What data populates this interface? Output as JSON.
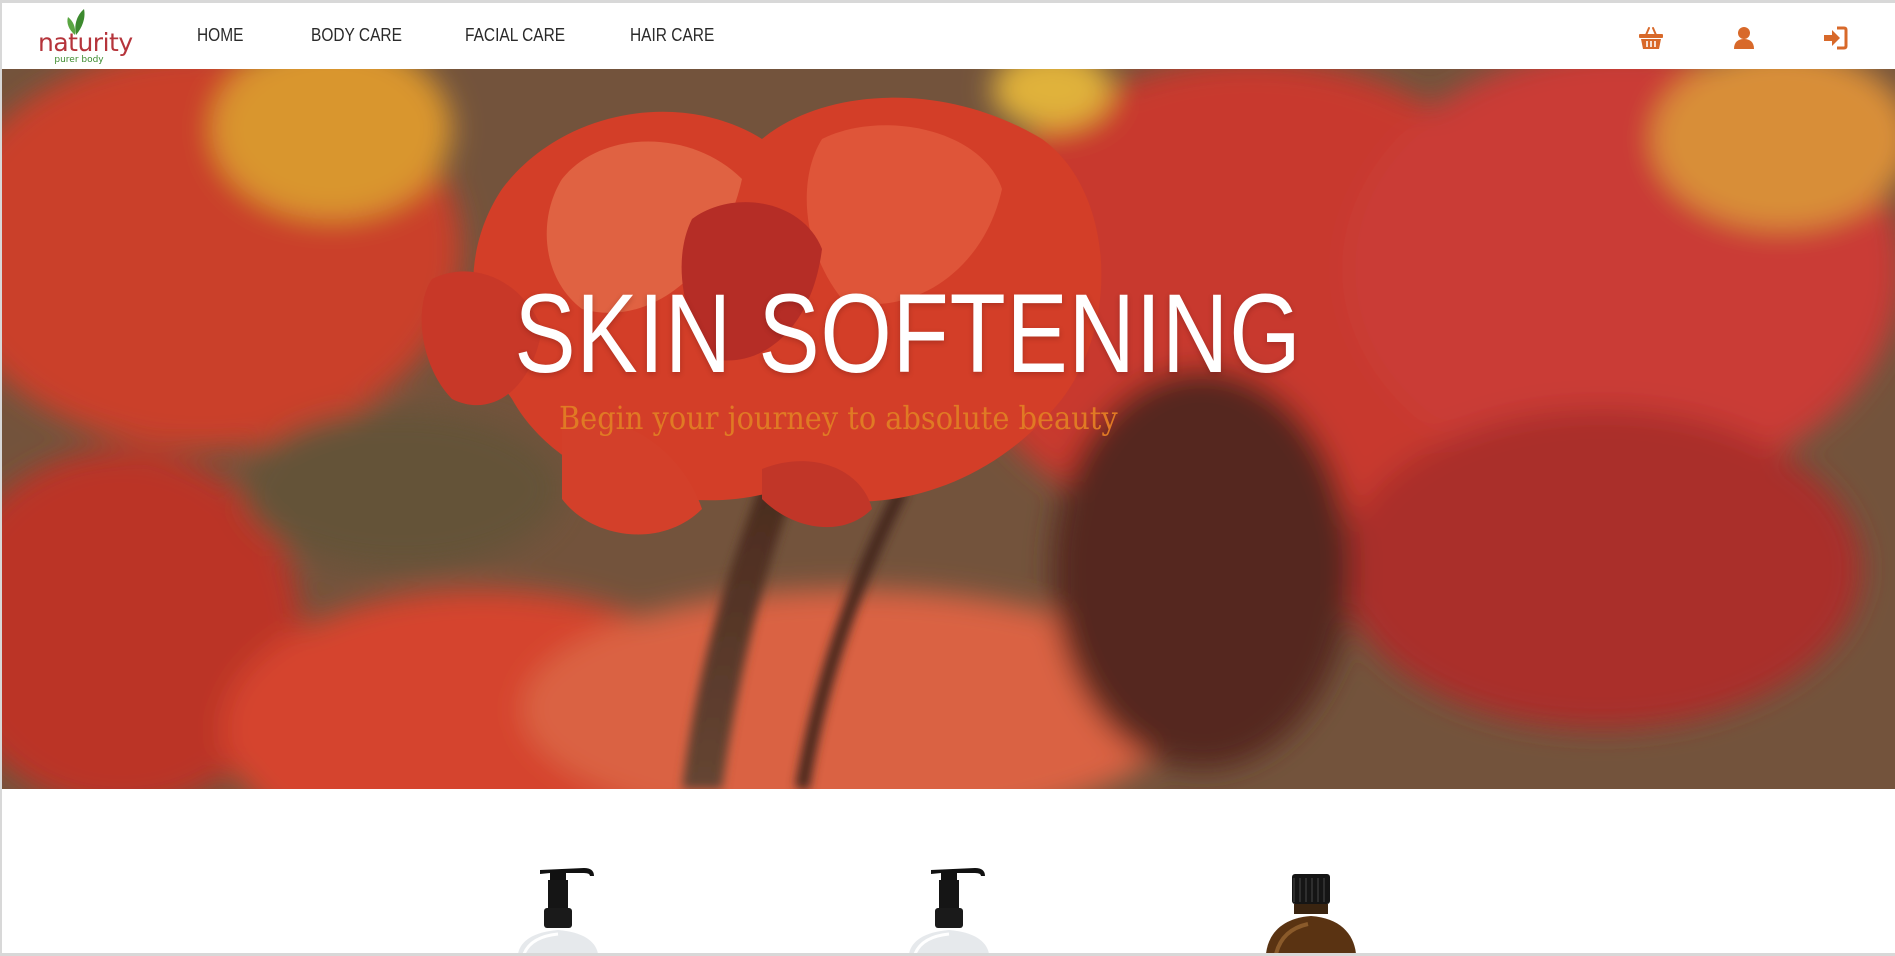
{
  "brand": {
    "name": "naturity",
    "tagline": "purer body",
    "name_color": "#b5343b",
    "tagline_color": "#3c8a2e",
    "leaf_color": "#3c8a2e"
  },
  "nav": {
    "items": [
      {
        "label": "HOME"
      },
      {
        "label": "BODY CARE"
      },
      {
        "label": "FACIAL CARE"
      },
      {
        "label": "HAIR CARE"
      }
    ]
  },
  "header_icons": [
    {
      "name": "basket-icon"
    },
    {
      "name": "user-icon"
    },
    {
      "name": "sign-in-icon"
    }
  ],
  "colors": {
    "accent": "#d8692a",
    "hero_subtitle": "#e07a24",
    "hero_title": "#ffffff"
  },
  "hero": {
    "title": "SKIN SOFTENING",
    "subtitle": "Begin your journey to absolute beauty"
  },
  "products": [
    {
      "name": "pump-bottle-white"
    },
    {
      "name": "pump-bottle-white"
    },
    {
      "name": "amber-dropper-bottle"
    }
  ]
}
